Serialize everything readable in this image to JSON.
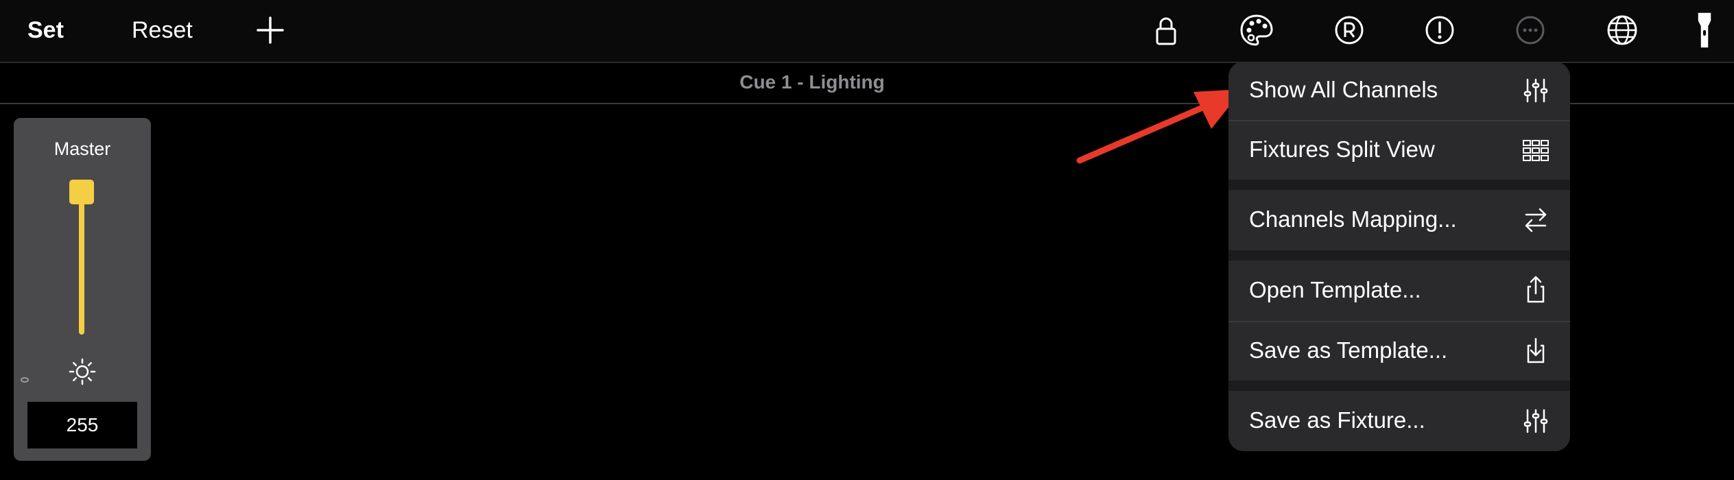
{
  "toolbar": {
    "set_label": "Set",
    "reset_label": "Reset",
    "icons": [
      "plus-icon",
      "lock-icon",
      "palette-icon",
      "registered-icon",
      "exclamation-icon",
      "more-icon",
      "globe-icon",
      "flashlight-icon"
    ]
  },
  "cue": {
    "title": "Cue 1 - Lighting"
  },
  "master": {
    "label": "Master",
    "value": "255",
    "level": 1.0,
    "color": "#f5cf43"
  },
  "menu": {
    "items": [
      {
        "label": "Show All Channels",
        "icon": "sliders-icon"
      },
      {
        "label": "Fixtures Split View",
        "icon": "grid-icon"
      },
      {
        "label": "Channels Mapping...",
        "icon": "arrows-swap-icon"
      },
      {
        "label": "Open Template...",
        "icon": "share-icon"
      },
      {
        "label": "Save as Template...",
        "icon": "download-icon"
      },
      {
        "label": "Save as Fixture...",
        "icon": "sliders-icon"
      }
    ]
  },
  "annotation": {
    "arrow_color": "#e8392a"
  }
}
